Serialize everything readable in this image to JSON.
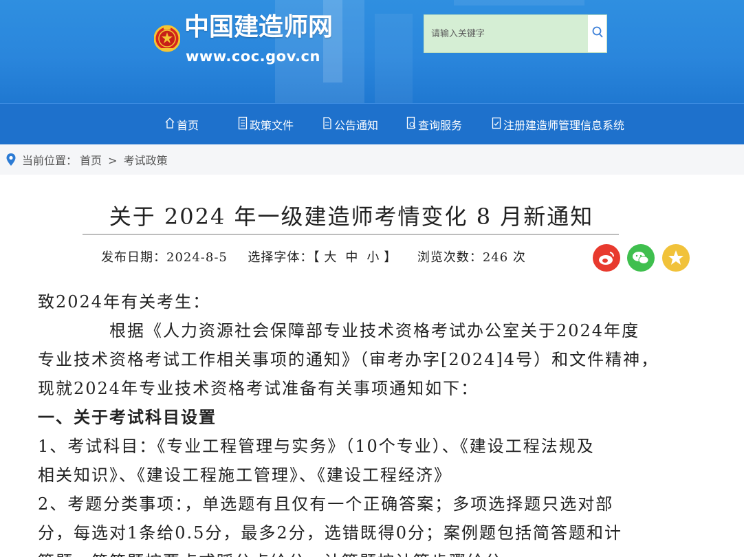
{
  "header": {
    "site_name": "中国建造师网",
    "site_url": "www.coc.gov.cn",
    "search_placeholder": "请输入关键字"
  },
  "nav": {
    "items": [
      {
        "label": "首页",
        "icon": "home-icon"
      },
      {
        "label": "政策文件",
        "icon": "document-icon"
      },
      {
        "label": "公告通知",
        "icon": "notice-icon"
      },
      {
        "label": "查询服务",
        "icon": "query-icon"
      },
      {
        "label": "注册建造师管理信息系统",
        "icon": "system-icon"
      }
    ]
  },
  "breadcrumb": {
    "prefix": "当前位置：",
    "home": "首页",
    "separator": ">",
    "current": "考试政策"
  },
  "article": {
    "title": "关于 2024 年一级建造师考情变化 8 月新通知",
    "meta": {
      "date_label": "发布日期：",
      "date": "2024-8-5",
      "font_label": "选择字体：",
      "bracket_open": "【",
      "font_large": "大",
      "font_medium": "中",
      "font_small": "小",
      "bracket_close": "】",
      "views_label": "浏览次数：",
      "views": "246",
      "views_unit": "次"
    },
    "lines": [
      "致2024年有关考生：",
      "根据《人力资源社会保障部专业技术资格考试办公室关于2024年度",
      "专业技术资格考试工作相关事项的通知》（审考办字[2024]4号）和文件精神，",
      "现就2024年专业技术资格考试准备有关事项通知如下：",
      "一、关于考试科目设置",
      "1、考试科目：《专业工程管理与实务》（10个专业）、《建设工程法规及",
      "相关知识》、《建设工程施工管理》、《建设工程经济》",
      "2、考题分类事项：，单选题有且仅有一个正确答案；多项选择题只选对部",
      "分，每选对1条给0.5分，最多2分，选错既得0分；案例题包括简答题和计",
      "算题，简答题按要点或踩分点给分，计算题按计算步骤给分"
    ]
  },
  "colors": {
    "banner": "#2a86dc",
    "nav": "#1e71cc",
    "search_bg": "#d5eed4",
    "weibo": "#e83a2e",
    "wechat": "#3fbf4e",
    "favorite": "#f1c23a"
  }
}
